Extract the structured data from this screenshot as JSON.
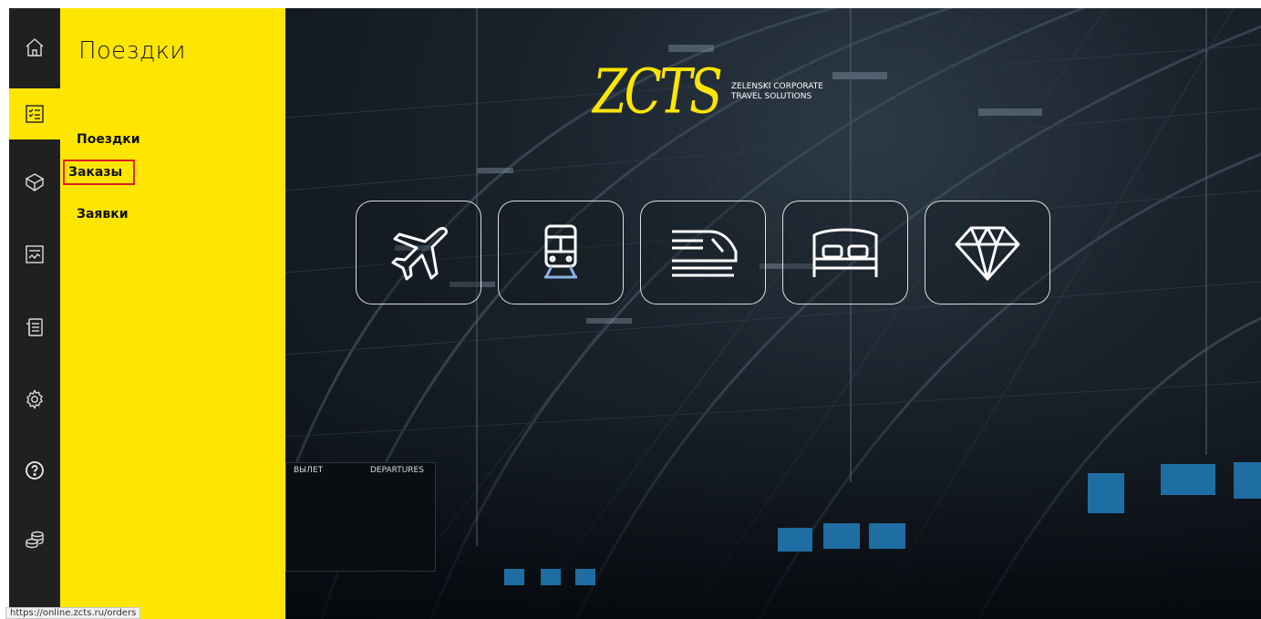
{
  "rail": {
    "items": [
      {
        "icon": "home-icon"
      },
      {
        "icon": "checklist-icon",
        "active": true
      },
      {
        "icon": "cube-icon"
      },
      {
        "icon": "chart-icon"
      },
      {
        "icon": "document-icon"
      },
      {
        "icon": "gear-icon"
      },
      {
        "icon": "help-icon"
      },
      {
        "icon": "coins-icon"
      }
    ]
  },
  "panel": {
    "title": "Поездки",
    "items": [
      {
        "label": "Поездки"
      },
      {
        "label": "Заказы"
      },
      {
        "label": "Заявки"
      }
    ]
  },
  "hero": {
    "logo_mark": "ZCTS",
    "logo_line1": "ZELENSKI CORPORATE",
    "logo_line2": "TRAVEL SOLUTIONS",
    "tiles": [
      {
        "icon": "airplane-icon"
      },
      {
        "icon": "train-icon"
      },
      {
        "icon": "high-speed-train-icon"
      },
      {
        "icon": "bed-icon"
      },
      {
        "icon": "diamond-icon"
      }
    ],
    "board_left": "ВЫЛЕТ",
    "board_right": "DEPARTURES"
  },
  "status_url": "https://online.zcts.ru/orders",
  "colors": {
    "accent": "#ffe600",
    "rail": "#202020",
    "highlight": "#e02020"
  }
}
